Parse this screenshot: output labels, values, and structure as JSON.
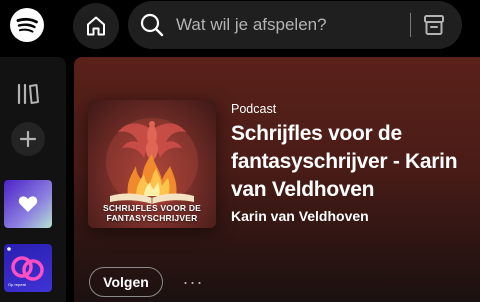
{
  "topbar": {
    "logo_icon": "spotify-logo",
    "home_icon": "home-icon",
    "search": {
      "placeholder": "Wat wil je afspelen?",
      "value": "",
      "browse_icon": "browse-icon"
    }
  },
  "sidebar": {
    "library_icon": "library-icon",
    "add_icon": "plus-icon",
    "liked_icon": "heart-icon",
    "playlist_tag": "Op repeat"
  },
  "podcast": {
    "type_label": "Podcast",
    "title": "Schrijfles voor de fantasyschrijver - Karin van Veldhoven",
    "author": "Karin van Veldhoven",
    "cover_line1": "SCHRIJFLES VOOR DE",
    "cover_line2": "FANTASYSCHRIJVER"
  },
  "actions": {
    "follow_label": "Volgen",
    "more_label": "···"
  },
  "colors": {
    "accent_green": "#1ed760",
    "header_gradient_top": "#5a211a",
    "surface": "#1f1f1f"
  }
}
